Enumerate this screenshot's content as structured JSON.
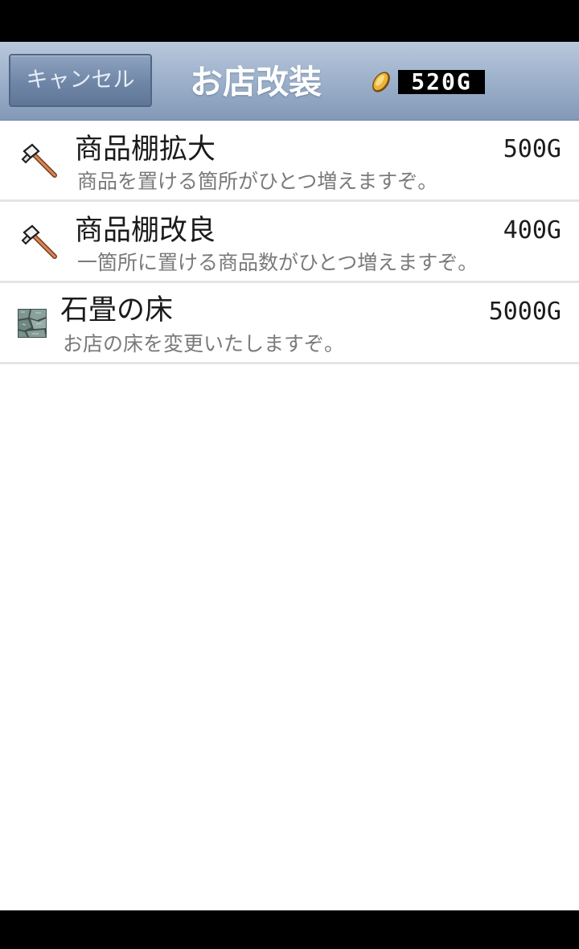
{
  "header": {
    "cancel_label": "キャンセル",
    "title": "お店改装",
    "money": "520G",
    "coin_icon": "gold-coin-icon"
  },
  "items": [
    {
      "icon": "hammer-icon",
      "name": "商品棚拡大",
      "price": "500G",
      "description": "商品を置ける箇所がひとつ増えますぞ。"
    },
    {
      "icon": "hammer-icon",
      "name": "商品棚改良",
      "price": "400G",
      "description": "一箇所に置ける商品数がひとつ増えますぞ。"
    },
    {
      "icon": "stone-floor-tile-icon",
      "name": "石畳の床",
      "price": "5000G",
      "description": "お店の床を変更いたしますぞ。"
    }
  ],
  "colors": {
    "header_top": "#b9c8dc",
    "header_bottom": "#8399b7",
    "button": "#6f86a7",
    "list_bg": "#ffffff",
    "divider": "#e4e4e4"
  }
}
